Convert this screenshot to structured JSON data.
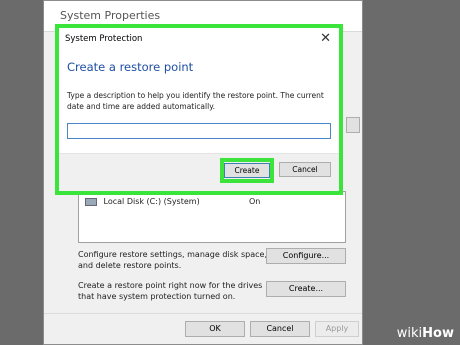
{
  "system_properties": {
    "title": "System Properties",
    "drive": {
      "name": "Local Disk (C:) (System)",
      "protection": "On"
    },
    "configure_text": "Configure restore settings, manage disk space, and delete restore points.",
    "configure_button": "Configure...",
    "create_text": "Create a restore point right now for the drives that have system protection turned on.",
    "create_button": "Create...",
    "ok_button": "OK",
    "cancel_button": "Cancel",
    "apply_button": "Apply"
  },
  "dialog": {
    "title": "System Protection",
    "close_glyph": "✕",
    "heading": "Create a restore point",
    "description": "Type a description to help you identify the restore point. The current date and time are added automatically.",
    "input_value": "",
    "create_button": "Create",
    "cancel_button": "Cancel"
  },
  "watermark": {
    "prefix": "wiki",
    "suffix": "How"
  },
  "colors": {
    "highlight": "#3ae43a",
    "heading": "#1e4fa3"
  }
}
